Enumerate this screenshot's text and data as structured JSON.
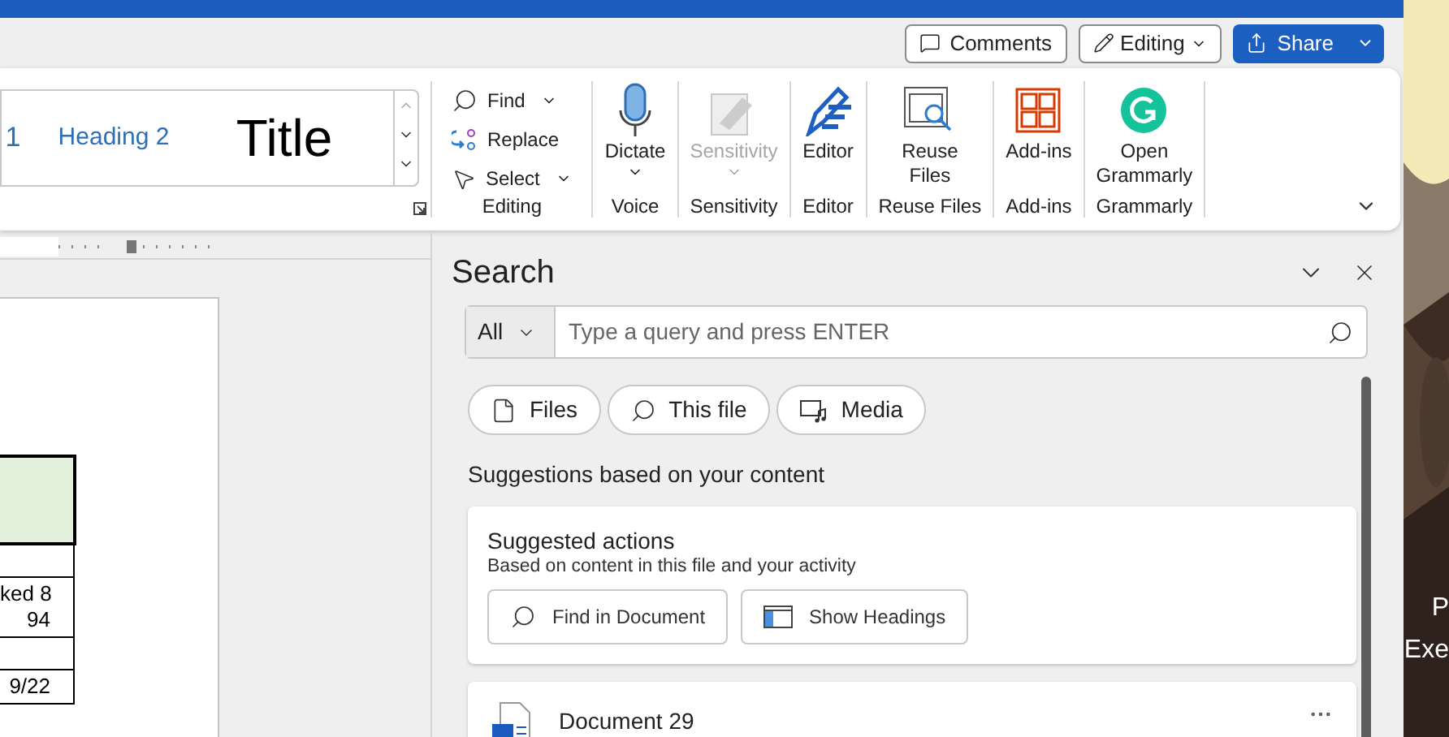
{
  "header_buttons": [
    {
      "kind": "comments",
      "label": "Comments"
    },
    {
      "kind": "editing",
      "label": "Editing"
    },
    {
      "kind": "share",
      "label": "Share"
    }
  ],
  "styles_gallery": [
    {
      "kind": "heading1",
      "label": "1"
    },
    {
      "kind": "heading2",
      "label": "Heading 2"
    },
    {
      "kind": "title",
      "label": "Title"
    }
  ],
  "ribbon_groups": [
    {
      "kind": "editing",
      "name": "Editing",
      "commands": [
        {
          "label": "Find",
          "dropdown": true
        },
        {
          "label": "Replace",
          "dropdown": false
        },
        {
          "label": "Select",
          "dropdown": true
        }
      ]
    },
    {
      "kind": "voice",
      "name": "Voice",
      "label": "Dictate",
      "dropdown": true,
      "disabled": false
    },
    {
      "kind": "sensitivity",
      "name": "Sensitivity",
      "label": "Sensitivity",
      "dropdown": true,
      "disabled": true
    },
    {
      "kind": "editor",
      "name": "Editor",
      "label": "Editor",
      "dropdown": false,
      "disabled": false
    },
    {
      "kind": "reuse",
      "name": "Reuse Files",
      "label": "Reuse\nFiles",
      "dropdown": false,
      "disabled": false
    },
    {
      "kind": "addins",
      "name": "Add-ins",
      "label": "Add-ins",
      "dropdown": false,
      "disabled": false
    },
    {
      "kind": "grammarly",
      "name": "Grammarly",
      "label": "Open\nGrammarly",
      "dropdown": false,
      "disabled": false
    }
  ],
  "document_table": [
    {
      "kind": "header"
    },
    {
      "kind": "row"
    },
    {
      "kind": "row",
      "text": "ked 8\n94"
    },
    {
      "kind": "row"
    },
    {
      "kind": "row",
      "text": "9/22"
    }
  ],
  "search_pane": {
    "title": "Search",
    "scope": "All",
    "placeholder": "Type a query and press ENTER",
    "filters": [
      {
        "label": "Files"
      },
      {
        "label": "This file"
      },
      {
        "label": "Media"
      }
    ],
    "section_heading": "Suggestions based on your content",
    "suggested": {
      "title": "Suggested actions",
      "subtitle": "Based on content in this file and your activity",
      "actions": [
        {
          "label": "Find in Document"
        },
        {
          "label": "Show Headings"
        }
      ]
    },
    "results": [
      {
        "name": "Document 29"
      }
    ]
  },
  "desktop_labels": [
    "P",
    "Exe"
  ]
}
